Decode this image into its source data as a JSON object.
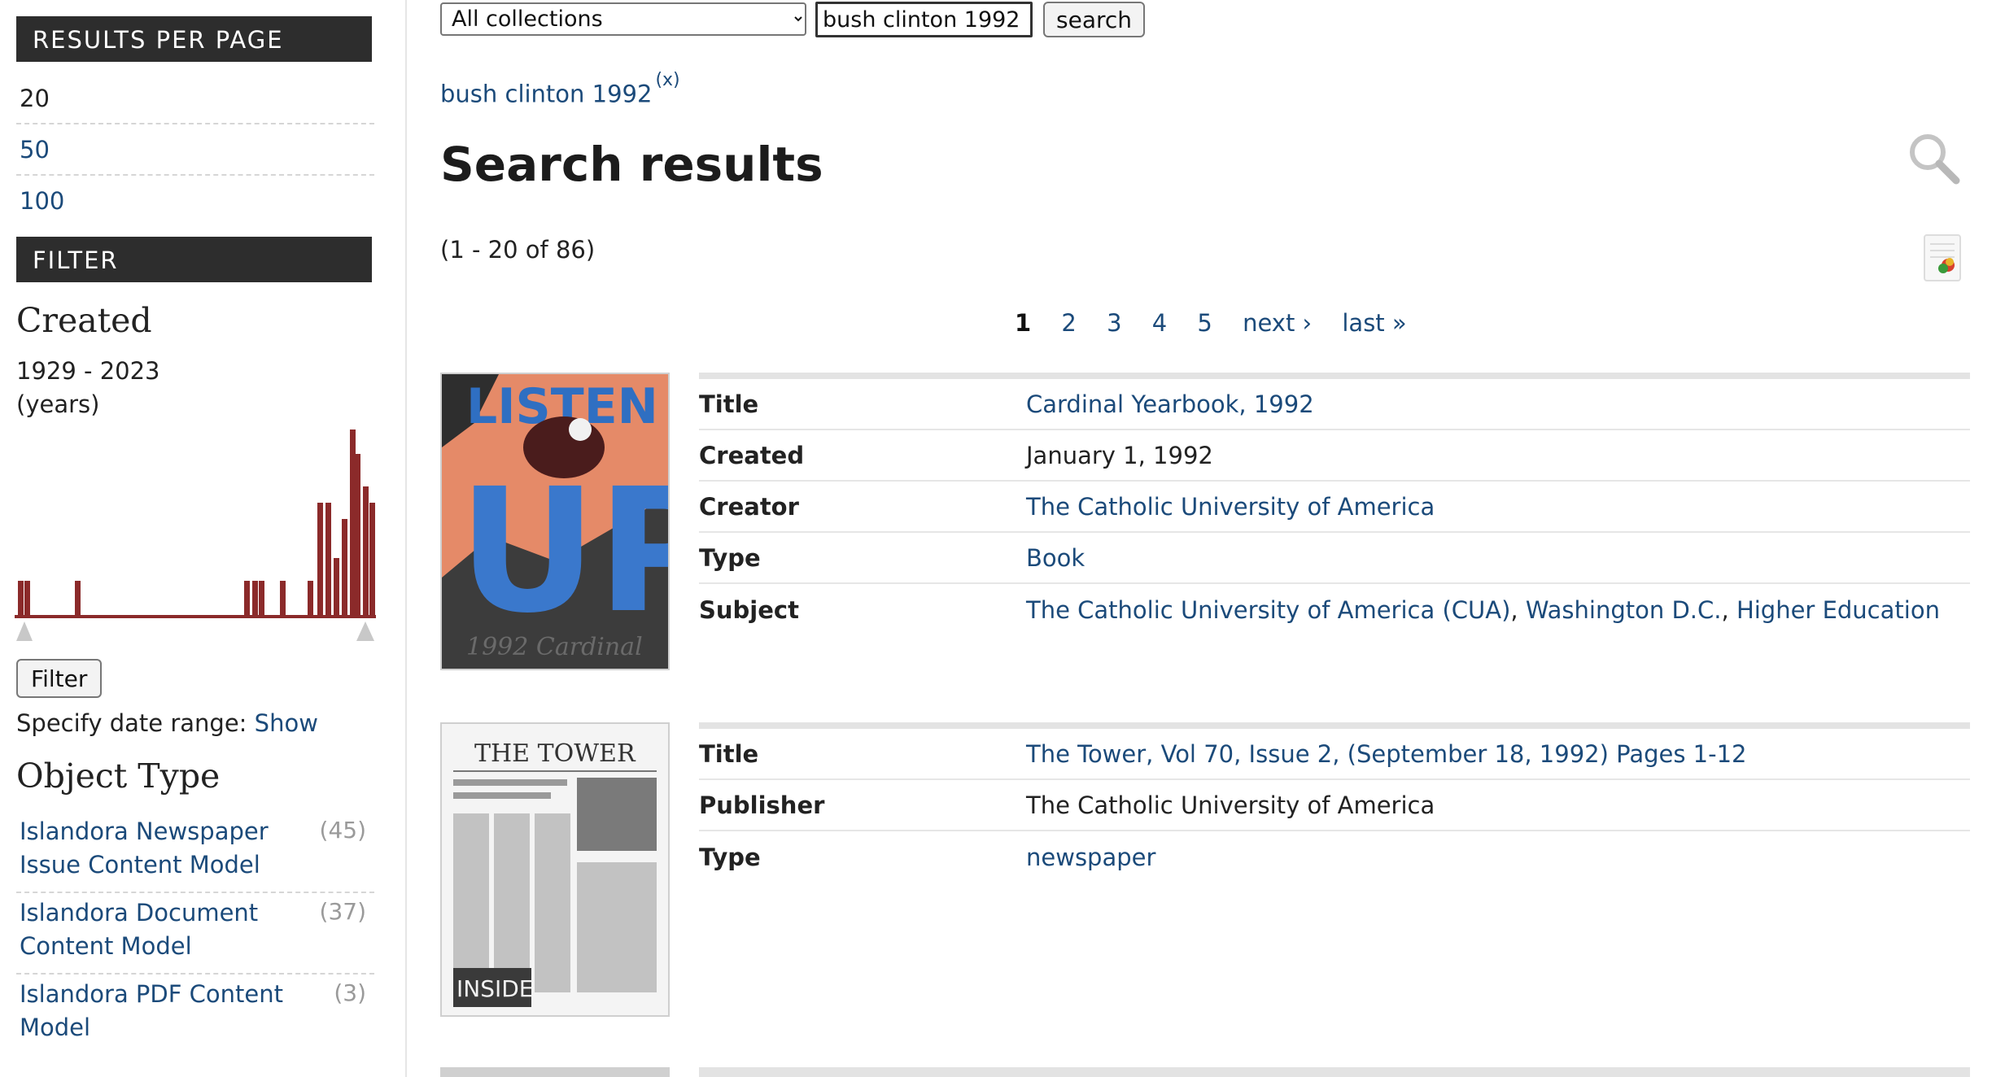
{
  "sidebar": {
    "results_per_page": {
      "title": "RESULTS PER PAGE",
      "options": [
        {
          "label": "20",
          "current": true
        },
        {
          "label": "50",
          "current": false
        },
        {
          "label": "100",
          "current": false
        }
      ]
    },
    "filter": {
      "title": "FILTER",
      "created": {
        "heading": "Created",
        "range": "1929 - 2023",
        "unit": "(years)",
        "histogram_color": "#8b2a2a",
        "filter_button": "Filter",
        "date_range_label": "Specify date range:",
        "date_range_link": "Show"
      },
      "object_type": {
        "heading": "Object Type",
        "items": [
          {
            "label": "Islandora Newspaper Issue Content Model",
            "count": "(45)"
          },
          {
            "label": "Islandora Document Content Model",
            "count": "(37)"
          },
          {
            "label": "Islandora PDF Content Model",
            "count": "(3)"
          }
        ]
      }
    }
  },
  "search": {
    "collection_selected": "All collections",
    "query_value": "bush clinton 1992",
    "button_label": "search",
    "active_query": "bush clinton 1992",
    "remove_label": "(x)"
  },
  "main": {
    "title": "Search results",
    "count_text": "(1 - 20 of 86)",
    "pager": [
      "1",
      "2",
      "3",
      "4",
      "5",
      "next ›",
      "last »"
    ],
    "results": [
      {
        "thumb_text_top": "LISTEN",
        "thumb_text_big": "UP",
        "thumb_text_bottom": "1992 Cardinal",
        "fields": [
          {
            "label": "Title",
            "value": "Cardinal Yearbook, 1992",
            "link": true
          },
          {
            "label": "Created",
            "value": "January 1, 1992",
            "link": false
          },
          {
            "label": "Creator",
            "value": "The Catholic University of America",
            "link": true
          },
          {
            "label": "Type",
            "value": "Book",
            "link": true
          },
          {
            "label": "Subject",
            "values": [
              "The Catholic University of America (CUA)",
              "Washington D.C.",
              "Higher Education"
            ],
            "link": true
          }
        ]
      },
      {
        "thumb_text_top": "THE TOWER",
        "thumb_text_bottom": "INSIDE",
        "fields": [
          {
            "label": "Title",
            "value": "The Tower, Vol 70, Issue 2, (September 18, 1992) Pages 1-12",
            "link": true
          },
          {
            "label": "Publisher",
            "value": "The Catholic University of America",
            "link": false
          },
          {
            "label": "Type",
            "value": "newspaper",
            "link": true
          }
        ]
      }
    ]
  }
}
